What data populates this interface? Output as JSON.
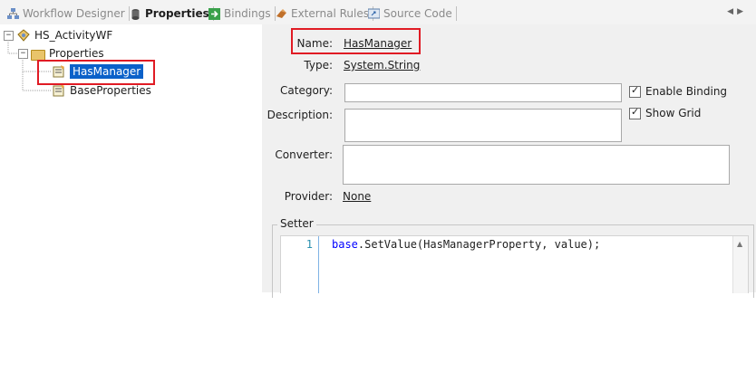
{
  "tabs": [
    {
      "label": "Workflow Designer",
      "icon": "workflow-designer-icon",
      "active": false
    },
    {
      "label": "Properties",
      "icon": "properties-icon",
      "active": true
    },
    {
      "label": "Bindings",
      "icon": "bindings-icon",
      "active": false
    },
    {
      "label": "External Rules",
      "icon": "external-rules-icon",
      "active": false
    },
    {
      "label": "Source Code",
      "icon": "source-code-icon",
      "active": false
    }
  ],
  "tree": {
    "root": {
      "label": "HS_ActivityWF",
      "expander": "−"
    },
    "properties_folder": {
      "label": "Properties",
      "expander": "−"
    },
    "items": [
      {
        "label": "HasManager",
        "selected": true
      },
      {
        "label": "BaseProperties",
        "selected": false
      }
    ]
  },
  "details": {
    "name_label": "Name:",
    "name_value": "HasManager",
    "type_label": "Type:",
    "type_value": "System.String",
    "category_label": "Category:",
    "category_value": "",
    "description_label": "Description:",
    "description_value": "",
    "converter_label": "Converter:",
    "converter_value": "",
    "provider_label": "Provider:",
    "provider_value": "None",
    "enable_binding_label": "Enable Binding",
    "enable_binding_checked": true,
    "show_grid_label": "Show Grid",
    "show_grid_checked": true
  },
  "setter": {
    "group_label": "Setter",
    "line_number": "1",
    "code_keyword": "base",
    "code_rest": ".SetValue(HasManagerProperty, value);"
  },
  "colors": {
    "highlight_box": "#e01b24",
    "selection": "#0b61c9",
    "panel_bg": "#f0f0f0"
  }
}
